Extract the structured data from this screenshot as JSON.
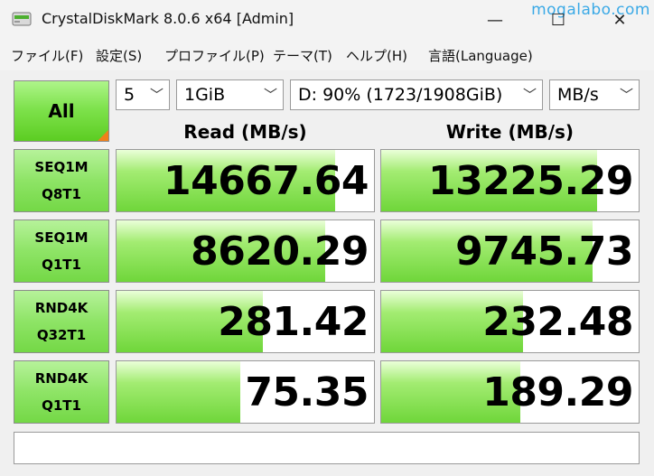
{
  "window": {
    "title": "CrystalDiskMark 8.0.6 x64 [Admin]",
    "minimize_glyph": "—",
    "maximize_glyph": "☐",
    "close_glyph": "✕",
    "watermark": "mogalabo.com"
  },
  "menu": [
    "ファイル(F)",
    "設定(S)",
    "プロファイル(P)",
    "テーマ(T)",
    "ヘルプ(H)",
    "言語(Language)"
  ],
  "controls": {
    "all_label": "All",
    "count": "5",
    "size": "1GiB",
    "drive": "D: 90% (1723/1908GiB)",
    "unit": "MB/s"
  },
  "headers": {
    "read": "Read (MB/s)",
    "write": "Write (MB/s)"
  },
  "rows": [
    {
      "line1": "SEQ1M",
      "line2": "Q8T1",
      "read": "14667.64",
      "write": "13225.29",
      "read_fill": 0.85,
      "write_fill": 0.84
    },
    {
      "line1": "SEQ1M",
      "line2": "Q1T1",
      "read": "8620.29",
      "write": "9745.73",
      "read_fill": 0.81,
      "write_fill": 0.82
    },
    {
      "line1": "RND4K",
      "line2": "Q32T1",
      "read": "281.42",
      "write": "232.48",
      "read_fill": 0.57,
      "write_fill": 0.55
    },
    {
      "line1": "RND4K",
      "line2": "Q1T1",
      "read": "75.35",
      "write": "189.29",
      "read_fill": 0.48,
      "write_fill": 0.54
    }
  ],
  "comment": "",
  "colors": {
    "bar_green": "#6fd63a",
    "label_green": "#8ee466",
    "corner_orange": "#f0801a",
    "watermark": "#3aa9e6"
  }
}
